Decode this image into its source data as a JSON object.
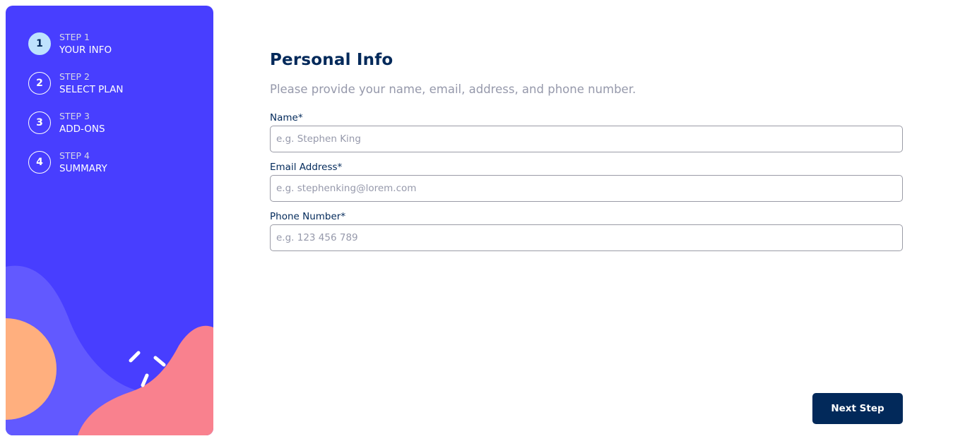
{
  "sidebar": {
    "steps": [
      {
        "number": "1",
        "label": "STEP 1",
        "title": "YOUR INFO",
        "active": true
      },
      {
        "number": "2",
        "label": "STEP 2",
        "title": "SELECT PLAN",
        "active": false
      },
      {
        "number": "3",
        "label": "STEP 3",
        "title": "ADD-ONS",
        "active": false
      },
      {
        "number": "4",
        "label": "STEP 4",
        "title": "SUMMARY",
        "active": false
      }
    ]
  },
  "form": {
    "title": "Personal Info",
    "subtitle": "Please provide your name, email, address, and phone number.",
    "fields": [
      {
        "label": "Name*",
        "placeholder": "e.g. Stephen King",
        "value": ""
      },
      {
        "label": "Email Address*",
        "placeholder": "e.g. stephenking@lorem.com",
        "value": ""
      },
      {
        "label": "Phone Number*",
        "placeholder": "e.g. 123 456 789",
        "value": ""
      }
    ],
    "next_label": "Next Step"
  },
  "colors": {
    "sidebar_bg": "#483eff",
    "active_step": "#bee2fd",
    "primary": "#02295a",
    "muted": "#9699ab",
    "shape_orange": "#ffaf7e",
    "shape_pink": "#f9818e",
    "shape_violet": "#6259ff"
  }
}
